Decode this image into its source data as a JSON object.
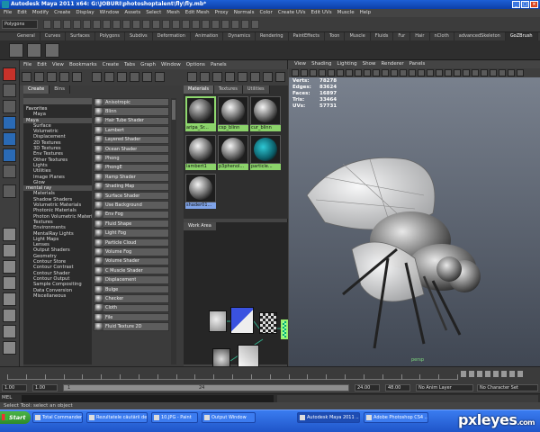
{
  "window": {
    "title": "Autodesk Maya 2011 x64: G:\\JOBURI\\photoshoptalent\\fly\\fly.mb*",
    "controls": [
      "_",
      "□",
      "×"
    ]
  },
  "menubar": [
    "File",
    "Edit",
    "Modify",
    "Create",
    "Display",
    "Window",
    "Assets",
    "Select",
    "Mesh",
    "Edit Mesh",
    "Proxy",
    "Normals",
    "Color",
    "Create UVs",
    "Edit UVs",
    "Muscle",
    "Help"
  ],
  "statusline": {
    "mode": "Polygons"
  },
  "shelf_tabs": [
    "General",
    "Curves",
    "Surfaces",
    "Polygons",
    "Subdivs",
    "Deformation",
    "Animation",
    "Dynamics",
    "Rendering",
    "PaintEffects",
    "Toon",
    "Muscle",
    "Fluids",
    "Fur",
    "Hair",
    "nCloth",
    "advancedSkeleton",
    "GoZBrush"
  ],
  "shelf_active_tab": "GoZBrush",
  "hypershade": {
    "menu": [
      "File",
      "Edit",
      "View",
      "Bookmarks",
      "Create",
      "Tabs",
      "Graph",
      "Window",
      "Options",
      "Panels"
    ],
    "create_tabs": [
      "Create",
      "Bins"
    ],
    "tree": [
      {
        "label": "Favorites",
        "type": "cat"
      },
      {
        "label": "Maya",
        "type": "item"
      },
      {
        "label": "Maya",
        "type": "cat open"
      },
      {
        "label": "Surface",
        "type": "item"
      },
      {
        "label": "Volumetric",
        "type": "item"
      },
      {
        "label": "Displacement",
        "type": "item"
      },
      {
        "label": "2D Textures",
        "type": "item"
      },
      {
        "label": "3D Textures",
        "type": "item"
      },
      {
        "label": "Env Textures",
        "type": "item"
      },
      {
        "label": "Other Textures",
        "type": "item"
      },
      {
        "label": "Lights",
        "type": "item"
      },
      {
        "label": "Utilities",
        "type": "item"
      },
      {
        "label": "Image Planes",
        "type": "item"
      },
      {
        "label": "Glow",
        "type": "item"
      },
      {
        "label": "mental ray",
        "type": "cat open"
      },
      {
        "label": "Materials",
        "type": "item"
      },
      {
        "label": "Shadow Shaders",
        "type": "item"
      },
      {
        "label": "Volumetric Materials",
        "type": "item"
      },
      {
        "label": "Photonic Materials",
        "type": "item"
      },
      {
        "label": "Photon Volumetric Materi...",
        "type": "item"
      },
      {
        "label": "Textures",
        "type": "item"
      },
      {
        "label": "Environments",
        "type": "item"
      },
      {
        "label": "MentalRay Lights",
        "type": "item"
      },
      {
        "label": "Light Maps",
        "type": "item"
      },
      {
        "label": "Lenses",
        "type": "item"
      },
      {
        "label": "Output Shaders",
        "type": "item"
      },
      {
        "label": "Geometry",
        "type": "item"
      },
      {
        "label": "Contour Store",
        "type": "item"
      },
      {
        "label": "Contour Contrast",
        "type": "item"
      },
      {
        "label": "Contour Shader",
        "type": "item"
      },
      {
        "label": "Contour Output",
        "type": "item"
      },
      {
        "label": "Sample Compositing",
        "type": "item"
      },
      {
        "label": "Data Conversion",
        "type": "item"
      },
      {
        "label": "Miscellaneous",
        "type": "item"
      }
    ],
    "node_list": [
      "Anisotropic",
      "Blinn",
      "Hair Tube Shader",
      "Lambert",
      "Layered Shader",
      "Ocean Shader",
      "Phong",
      "PhongE",
      "Ramp Shader",
      "Shading Map",
      "Surface Shader",
      "Use Background",
      "Env Fog",
      "Fluid Shape",
      "Light Fog",
      "Particle Cloud",
      "Volume Fog",
      "Volume Shader",
      "C Muscle Shader",
      "Displacement",
      "Bulge",
      "Checker",
      "Cloth",
      "File",
      "Fluid Texture 2D"
    ],
    "material_tabs": [
      "Materials",
      "Textures",
      "Utilities"
    ],
    "materials": [
      {
        "label": "aripa_Sr...",
        "kind": "tex",
        "selected": true,
        "color": "green"
      },
      {
        "label": "csp_blinn",
        "kind": "plain",
        "selected": false,
        "color": "green"
      },
      {
        "label": "cur_blinn",
        "kind": "plain",
        "selected": false,
        "color": "green"
      },
      {
        "label": "lambert1",
        "kind": "plain",
        "selected": false,
        "color": "green"
      },
      {
        "label": "p3phenol...",
        "kind": "plain",
        "selected": false,
        "color": "green"
      },
      {
        "label": "particle...",
        "kind": "par",
        "selected": false,
        "color": "green"
      },
      {
        "label": "shader01...",
        "kind": "plain",
        "selected": false,
        "color": "blue"
      }
    ],
    "work_area_tab": "Work Area"
  },
  "viewport": {
    "menu": [
      "View",
      "Shading",
      "Lighting",
      "Show",
      "Renderer",
      "Panels"
    ],
    "hud": [
      {
        "k": "Verts:",
        "v": "78278"
      },
      {
        "k": "Edges:",
        "v": "83624"
      },
      {
        "k": "Faces:",
        "v": "16897"
      },
      {
        "k": "Tris:",
        "v": "33464"
      },
      {
        "k": "UVs:",
        "v": "57731"
      }
    ],
    "axis_label": "persp"
  },
  "time": {
    "start": "1.00",
    "inner_start": "1.00",
    "current": "1",
    "range_mid": "24",
    "end": "24.00",
    "inner_end": "48.00",
    "anim_layer": "No Anim Layer",
    "char_set": "No Character Set"
  },
  "cmdline": {
    "label": "MEL"
  },
  "helpline": "Select Tool: select an object",
  "taskbar": {
    "start": "Start",
    "tasks": [
      {
        "label": "Total Commander 6.03 ...",
        "active": false
      },
      {
        "label": "Rezultatele căutării de i...",
        "active": false
      },
      {
        "label": "10.JPG - Paint",
        "active": false
      },
      {
        "label": "Output Window",
        "active": false
      },
      {
        "label": "Autodesk Maya 2011 ...",
        "active": true
      },
      {
        "label": "Adobe Photoshop CS4 ...",
        "active": false
      }
    ]
  },
  "watermark": {
    "main": "pxleyes",
    "suffix": ".com"
  }
}
